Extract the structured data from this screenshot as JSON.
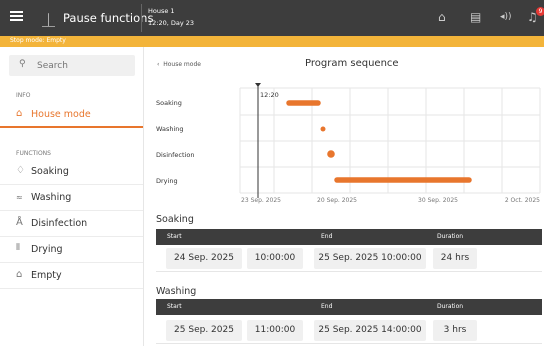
{
  "header": {
    "title": "Pause functions",
    "house_name": "House 1",
    "house_day": "12:20, Day 23",
    "alarm_count": "9",
    "icons": [
      "menu-icon",
      "pause-functions-icon",
      "house-icon",
      "document-icon",
      "sound-icon",
      "alarm-bell-icon"
    ]
  },
  "stop_bar": {
    "text": "Stop mode: Empty",
    "color": "#f3b43a"
  },
  "sidebar": {
    "search_placeholder": "Search",
    "info_label": "INFO",
    "info_items": [
      {
        "label": "House mode",
        "icon": "house-icon",
        "active": true
      }
    ],
    "functions_label": "FUNCTIONS",
    "function_items": [
      {
        "label": "Soaking",
        "icon": "droplet-icon"
      },
      {
        "label": "Washing",
        "icon": "spray-icon"
      },
      {
        "label": "Disinfection",
        "icon": "flask-icon"
      },
      {
        "label": "Drying",
        "icon": "heat-icon"
      },
      {
        "label": "Empty",
        "icon": "house-icon"
      }
    ]
  },
  "main": {
    "back_label": "House mode",
    "title": "Program sequence",
    "gantt": {
      "now_label": "12:20",
      "rows": [
        "Soaking",
        "Washing",
        "Disinfection",
        "Drying"
      ],
      "ticks": [
        "23 Sep. 2025",
        "20 Sep. 2025",
        "30 Sep. 2025",
        "2 Oct. 2025"
      ],
      "bar_color": "#e8762d"
    },
    "sections": [
      {
        "title": "Soaking",
        "headers": {
          "start": "Start",
          "end": "End",
          "duration": "Duration"
        },
        "start_date": "24 Sep. 2025",
        "start_time": "10:00:00",
        "end": "25 Sep. 2025 10:00:00",
        "duration": "24 hrs"
      },
      {
        "title": "Washing",
        "headers": {
          "start": "Start",
          "end": "End",
          "duration": "Duration"
        },
        "start_date": "25 Sep. 2025",
        "start_time": "11:00:00",
        "end": "25 Sep. 2025 14:00:00",
        "duration": "3 hrs"
      }
    ]
  },
  "colors": {
    "accent": "#e8762d",
    "topbar": "#3d3d3d",
    "table_header": "#3d3d3d"
  }
}
